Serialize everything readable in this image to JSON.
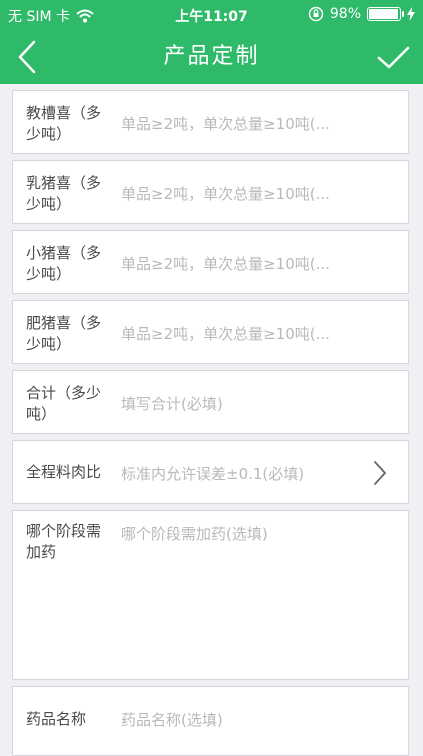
{
  "status_bar": {
    "carrier": "无 SIM 卡",
    "time": "上午11:07",
    "battery_percent": "98%",
    "battery_level": 0.98
  },
  "nav": {
    "title": "产品定制",
    "back_icon": "chevron-left-icon",
    "done_icon": "checkmark-icon"
  },
  "colors": {
    "accent": "#2fba6a",
    "label": "#4a4a4a",
    "placeholder": "#b9b9b9"
  },
  "fields": [
    {
      "label": "教槽喜（多少吨）",
      "placeholder": "单品≥2吨，单次总量≥10吨(..."
    },
    {
      "label": "乳猪喜（多少吨）",
      "placeholder": "单品≥2吨，单次总量≥10吨(..."
    },
    {
      "label": "小猪喜（多少吨）",
      "placeholder": "单品≥2吨，单次总量≥10吨(..."
    },
    {
      "label": "肥猪喜（多少吨）",
      "placeholder": "单品≥2吨，单次总量≥10吨(..."
    },
    {
      "label": "合计（多少吨）",
      "placeholder": "填写合计(必填)"
    },
    {
      "label": "全程料肉比",
      "placeholder": "标准内允许误差±0.1(必填)"
    },
    {
      "label": "哪个阶段需加药",
      "placeholder": "哪个阶段需加药(选填)"
    },
    {
      "label": "药品名称",
      "placeholder": "药品名称(选填)"
    }
  ]
}
